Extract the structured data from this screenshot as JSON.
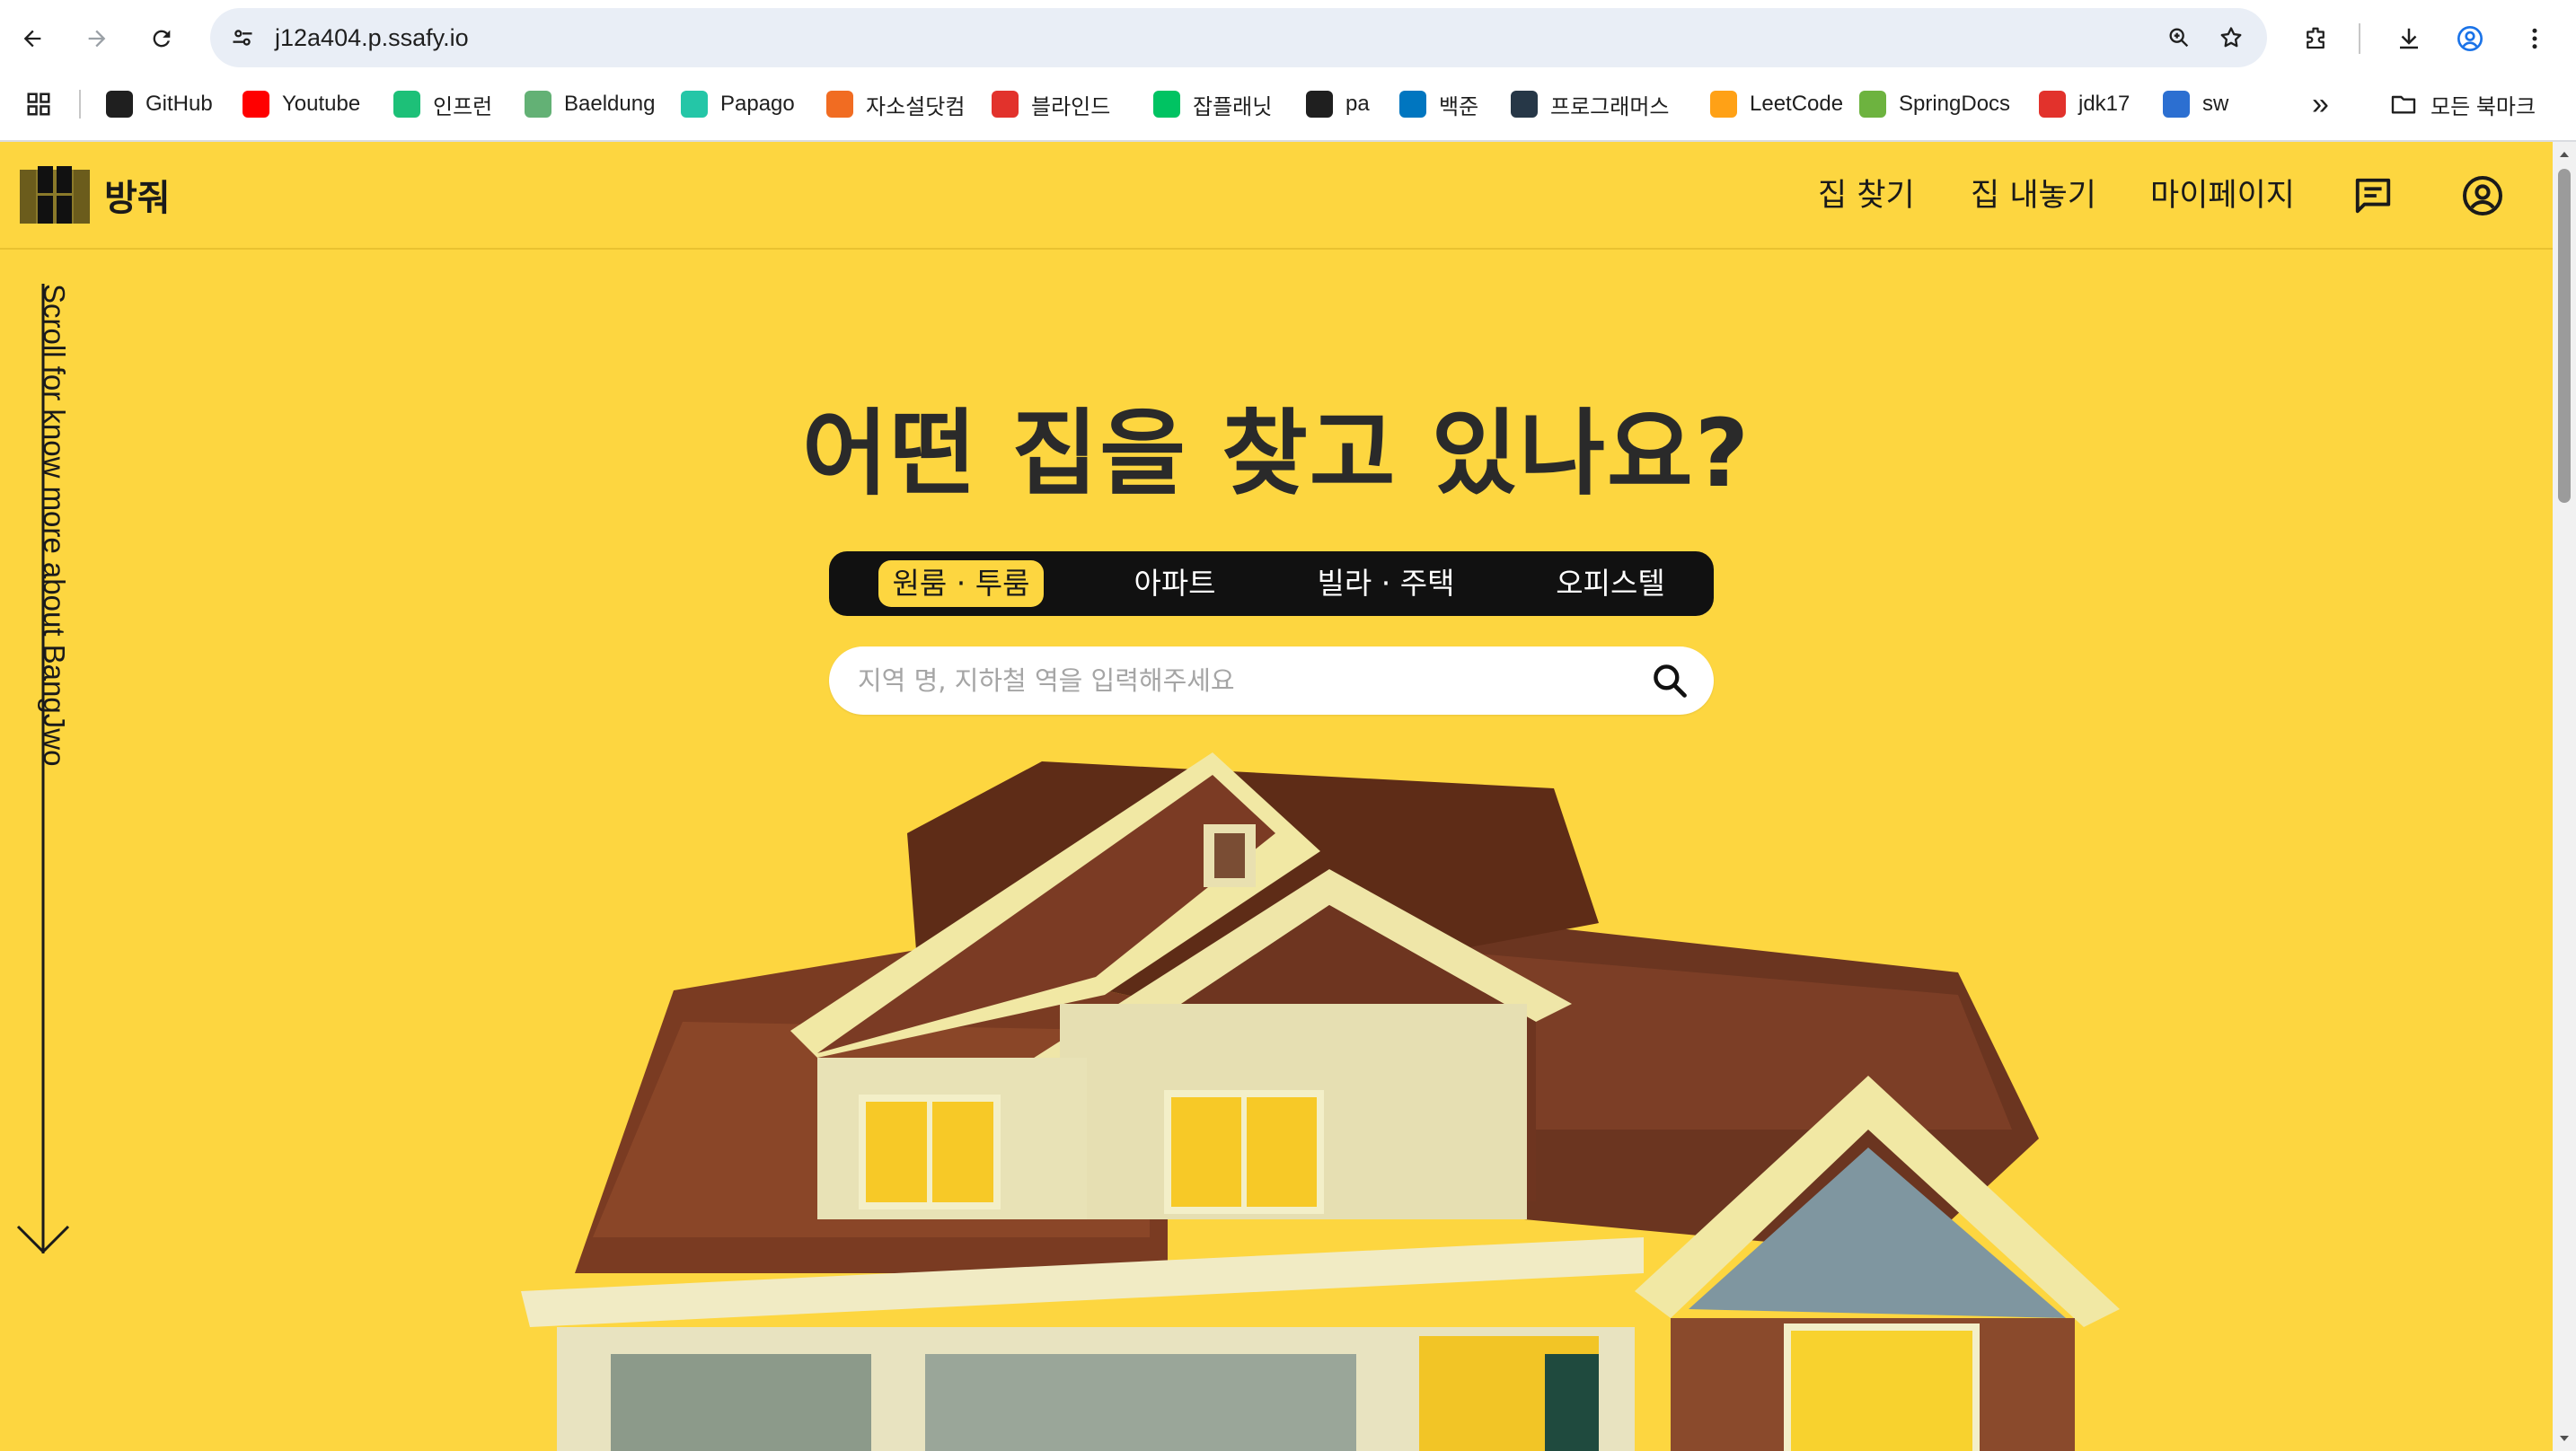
{
  "browser": {
    "url": "j12a404.p.ssafy.io",
    "bookmarks": [
      {
        "label": "GitHub",
        "icon": "github-icon",
        "color": "#1f1f1f"
      },
      {
        "label": "Youtube",
        "icon": "youtube-icon",
        "color": "#ff0000"
      },
      {
        "label": "인프런",
        "icon": "inflearn-icon",
        "color": "#1dc078"
      },
      {
        "label": "Baeldung",
        "icon": "baeldung-icon",
        "color": "#63b175"
      },
      {
        "label": "Papago",
        "icon": "papago-icon",
        "color": "#24c6a7"
      },
      {
        "label": "자소설닷컴",
        "icon": "jasoseol-icon",
        "color": "#f16c22"
      },
      {
        "label": "블라인드",
        "icon": "blind-icon",
        "color": "#e2322c"
      },
      {
        "label": "잡플래닛",
        "icon": "jobplanet-icon",
        "color": "#00c362"
      },
      {
        "label": "pa",
        "icon": "openai-icon",
        "color": "#1f1f1f"
      },
      {
        "label": "백준",
        "icon": "baekjoon-icon",
        "color": "#0076c0"
      },
      {
        "label": "프로그래머스",
        "icon": "programmers-icon",
        "color": "#263747"
      },
      {
        "label": "LeetCode",
        "icon": "leetcode-icon",
        "color": "#ffa116"
      },
      {
        "label": "SpringDocs",
        "icon": "spring-icon",
        "color": "#6db33f"
      },
      {
        "label": "jdk17",
        "icon": "oracle-icon",
        "color": "#e2322c"
      },
      {
        "label": "sw",
        "icon": "swea-icon",
        "color": "#2c6fd1"
      }
    ],
    "all_bookmarks_label": "모든 북마크"
  },
  "site": {
    "logo_text": "방줘",
    "nav": {
      "find_home": "집 찾기",
      "list_home": "집 내놓기",
      "mypage": "마이페이지"
    },
    "scroll_hint": "Scroll for know more about BangJwo",
    "hero_title": "어떤 집을 찾고 있나요?",
    "tabs": [
      {
        "label": "원룸 · 투룸",
        "active": true
      },
      {
        "label": "아파트",
        "active": false
      },
      {
        "label": "빌라 · 주택",
        "active": false
      },
      {
        "label": "오피스텔",
        "active": false
      }
    ],
    "search": {
      "placeholder": "지역 명, 지하철 역을 입력해주세요",
      "value": ""
    }
  },
  "colors": {
    "brand_yellow": "#fdd640",
    "dark": "#111111"
  }
}
